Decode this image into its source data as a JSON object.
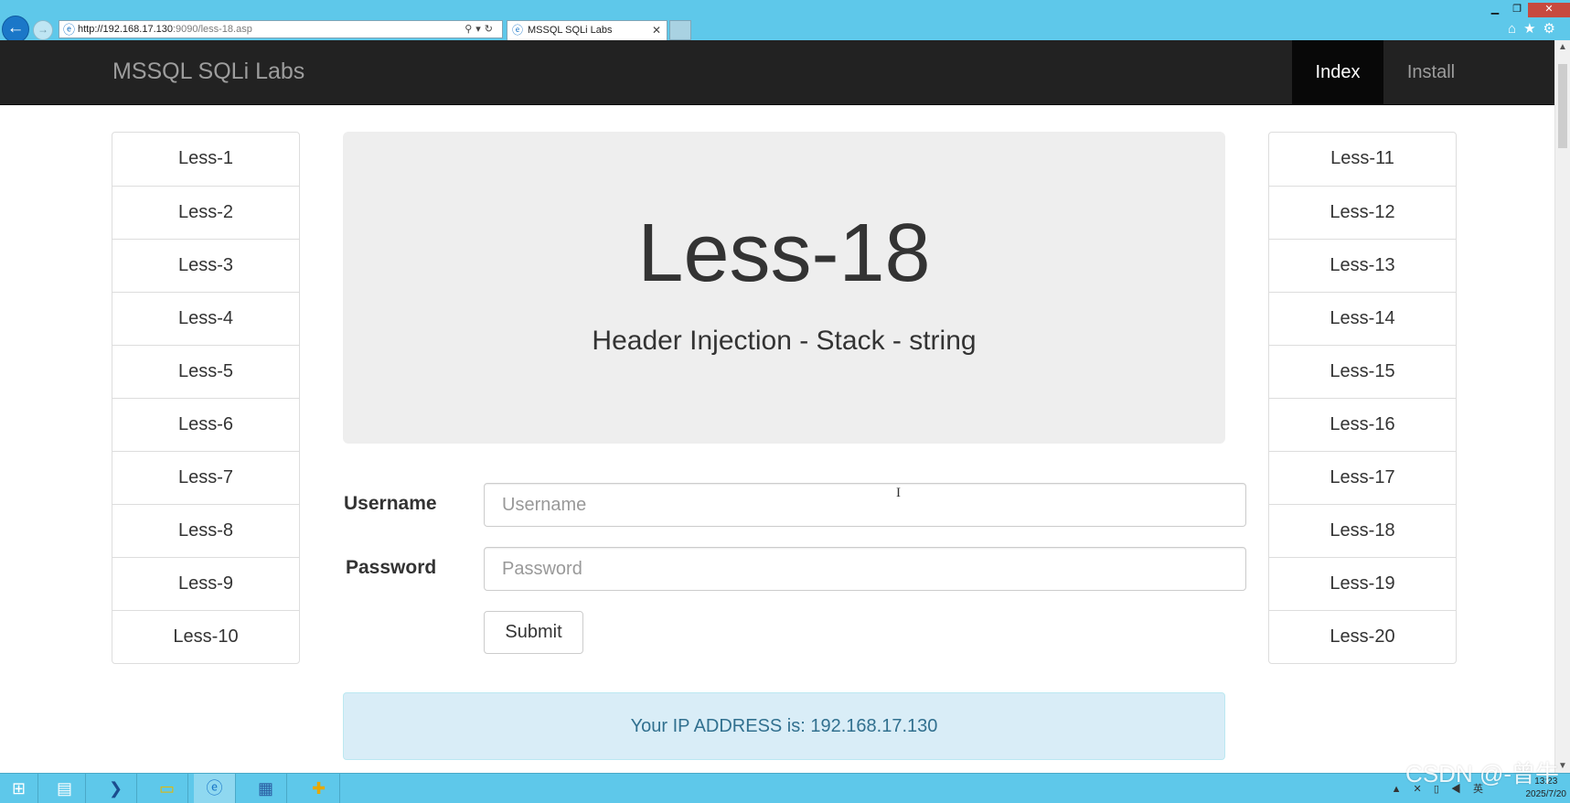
{
  "browser": {
    "url_host": "http://192.168.17.130",
    "url_path": ":9090/less-18.asp",
    "tab_title": "MSSQL SQLi Labs"
  },
  "navbar": {
    "brand": "MSSQL SQLi Labs",
    "links": [
      "Index",
      "Install"
    ]
  },
  "left_list": [
    "Less-1",
    "Less-2",
    "Less-3",
    "Less-4",
    "Less-5",
    "Less-6",
    "Less-7",
    "Less-8",
    "Less-9",
    "Less-10"
  ],
  "right_list": [
    "Less-11",
    "Less-12",
    "Less-13",
    "Less-14",
    "Less-15",
    "Less-16",
    "Less-17",
    "Less-18",
    "Less-19",
    "Less-20"
  ],
  "jumbotron": {
    "title": "Less-18",
    "subtitle": "Header Injection - Stack - string"
  },
  "form": {
    "username_label": "Username",
    "username_placeholder": "Username",
    "password_label": "Password",
    "password_placeholder": "Password",
    "submit_label": "Submit"
  },
  "alert": {
    "text": "Your IP ADDRESS is: 192.168.17.130"
  },
  "taskbar": {
    "date": "2025/7/20",
    "time": "13:23"
  },
  "watermark": "CSDN @-曾牛",
  "colors": {
    "navbar_bg": "#222222",
    "navbar_active_bg": "#080808",
    "jumbotron_bg": "#eeeeee",
    "alert_bg": "#d9edf7",
    "alert_text": "#31708f",
    "chrome_bg": "#5ec8ea"
  }
}
